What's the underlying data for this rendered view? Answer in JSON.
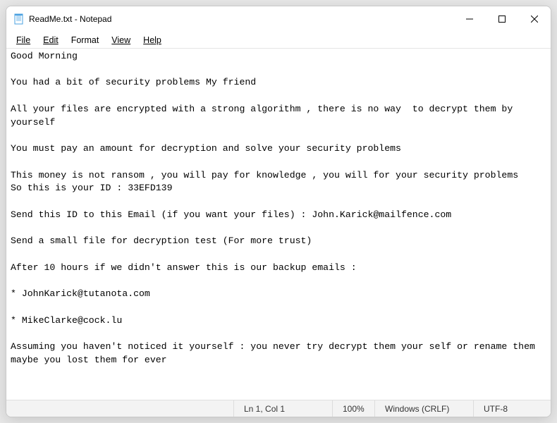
{
  "window": {
    "title": "ReadMe.txt - Notepad"
  },
  "menu": {
    "file": "File",
    "edit": "Edit",
    "format": "Format",
    "view": "View",
    "help": "Help"
  },
  "content": {
    "text": "Good Morning\n\nYou had a bit of security problems My friend\n\nAll your files are encrypted with a strong algorithm , there is no way  to decrypt them by yourself\n\nYou must pay an amount for decryption and solve your security problems\n\nThis money is not ransom , you will pay for knowledge , you will for your security problems\nSo this is your ID : 33EFD139\n\nSend this ID to this Email (if you want your files) : John.Karick@mailfence.com\n\nSend a small file for decryption test (For more trust)\n\nAfter 10 hours if we didn't answer this is our backup emails :\n\n* JohnKarick@tutanota.com\n\n* MikeClarke@cock.lu\n\nAssuming you haven't noticed it yourself : you never try decrypt them your self or rename them maybe you lost them for ever"
  },
  "status": {
    "position": "Ln 1, Col 1",
    "zoom": "100%",
    "lineending": "Windows (CRLF)",
    "encoding": "UTF-8"
  }
}
